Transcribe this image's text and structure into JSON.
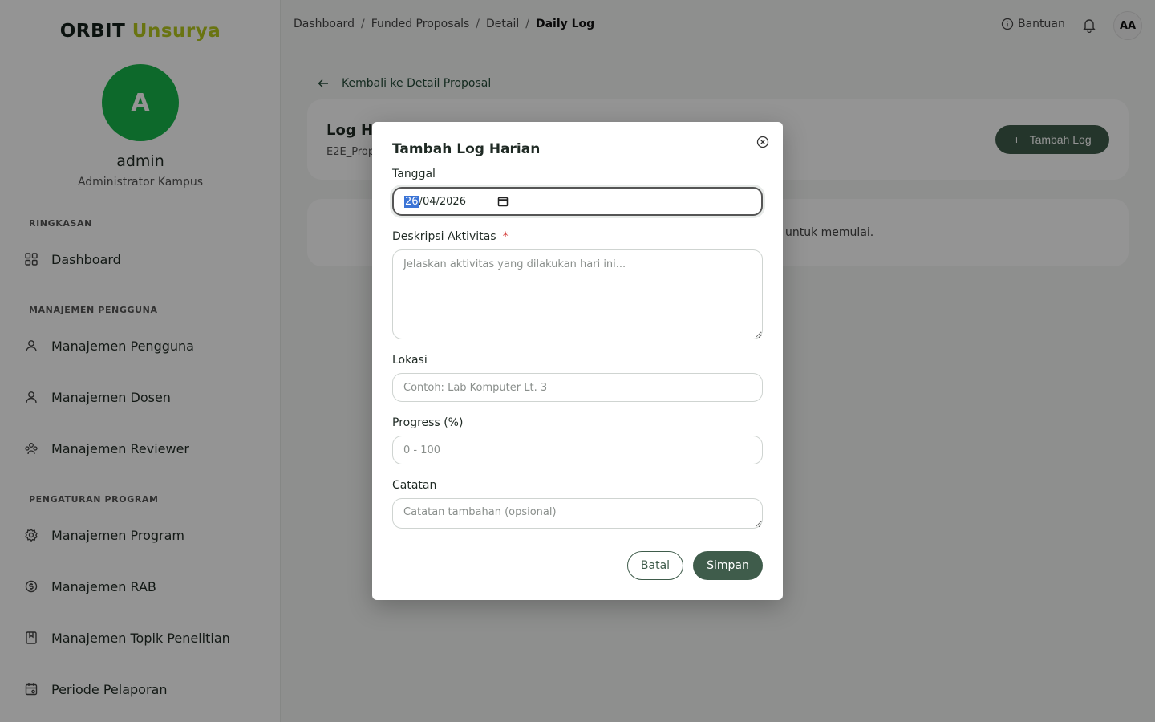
{
  "brand": {
    "part1": "ORBIT",
    "part2": "Unsurya",
    "accent": "#b6c81e"
  },
  "user": {
    "initial": "A",
    "name": "admin",
    "role": "Administrator Kampus",
    "avatar_color": "#17b64a"
  },
  "sidebar": {
    "sections": [
      {
        "label": "RINGKASAN",
        "items": [
          {
            "label": "Dashboard",
            "icon": "grid-icon"
          }
        ]
      },
      {
        "label": "MANAJEMEN PENGGUNA",
        "items": [
          {
            "label": "Manajemen Pengguna",
            "icon": "user-icon"
          },
          {
            "label": "Manajemen Dosen",
            "icon": "user-icon"
          },
          {
            "label": "Manajemen Reviewer",
            "icon": "users-icon"
          }
        ]
      },
      {
        "label": "PENGATURAN PROGRAM",
        "items": [
          {
            "label": "Manajemen Program",
            "icon": "gear-icon"
          },
          {
            "label": "Manajemen RAB",
            "icon": "money-icon"
          },
          {
            "label": "Manajemen Topik Penelitian",
            "icon": "bookmark-icon"
          },
          {
            "label": "Periode Pelaporan",
            "icon": "calendar-icon"
          }
        ]
      }
    ]
  },
  "header": {
    "breadcrumb": [
      "Dashboard",
      "Funded Proposals",
      "Detail",
      "Daily Log"
    ],
    "help_label": "Bantuan",
    "user_initials": "AA"
  },
  "page": {
    "back_label": "Kembali ke Detail Proposal",
    "title_visible": "Log Ha",
    "subtitle_visible": "E2E_Prop",
    "add_button": "Tambah Log",
    "empty_visible": "untuk memulai."
  },
  "modal": {
    "title": "Tambah Log Harian",
    "date_label": "Tanggal",
    "date_value": {
      "day": "26",
      "month": "04",
      "year": "2026"
    },
    "description_label": "Deskripsi Aktivitas",
    "required_mark": "*",
    "description_placeholder": "Jelaskan aktivitas yang dilakukan hari ini...",
    "location_label": "Lokasi",
    "location_placeholder": "Contoh: Lab Komputer Lt. 3",
    "progress_label": "Progress (%)",
    "progress_placeholder": "0 - 100",
    "notes_label": "Catatan",
    "notes_placeholder": "Catatan tambahan (opsional)",
    "cancel_label": "Batal",
    "save_label": "Simpan",
    "primary_color": "#3f5c4b"
  }
}
